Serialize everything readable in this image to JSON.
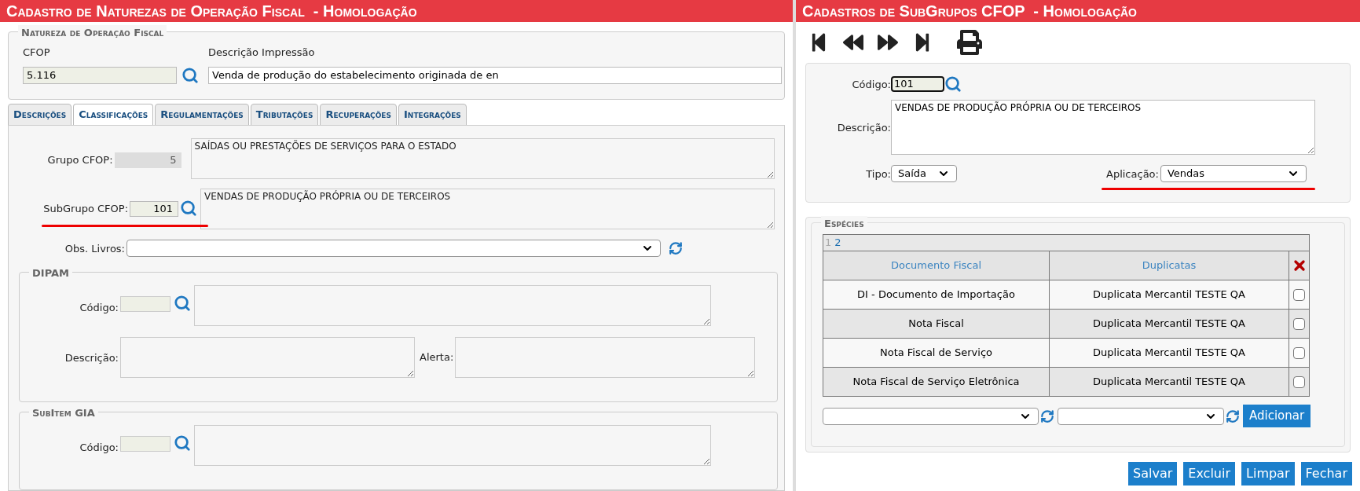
{
  "left_window": {
    "title": "Cadastro de Naturezas de Operação Fiscal  - Homologação",
    "natureza": {
      "legend": "Natureza de Operação Fiscal",
      "cfop_label": "CFOP",
      "cfop_value": "5.116",
      "descricao_label": "Descrição Impressão",
      "descricao_value": "Venda de produção do estabelecimento originada de en"
    },
    "tabs": [
      {
        "label": "Descrições",
        "selected": false
      },
      {
        "label": "Classificações",
        "selected": true
      },
      {
        "label": "Regulamentações",
        "selected": false
      },
      {
        "label": "Tributações",
        "selected": false
      },
      {
        "label": "Recuperações",
        "selected": false
      },
      {
        "label": "Integrações",
        "selected": false
      }
    ],
    "grupo": {
      "label": "Grupo CFOP:",
      "code": "5",
      "description": "SAÍDAS OU PRESTAÇÕES DE SERVIÇOS PARA O ESTADO"
    },
    "subgrupo": {
      "label": "SubGrupo CFOP:",
      "code": "101",
      "description": "VENDAS DE PRODUÇÃO PRÓPRIA OU DE TERCEIROS",
      "underlined": true
    },
    "obs_livros": {
      "label": "Obs. Livros:"
    },
    "dipam": {
      "legend": "DIPAM",
      "codigo_label": "Código:",
      "descricao_label": "Descrição:",
      "alerta_label": "Alerta:"
    },
    "subitem_gia": {
      "legend": "SubItem GIA",
      "codigo_label": "Código:"
    }
  },
  "right_window": {
    "title": "Cadastros de SubGrupos CFOP  - Homologação",
    "codigo": {
      "label": "Código:",
      "value": "101"
    },
    "descricao": {
      "label": "Descrição:",
      "value": "VENDAS DE PRODUÇÃO PRÓPRIA OU DE TERCEIROS"
    },
    "tipo": {
      "label": "Tipo:",
      "value": "Saída"
    },
    "aplicacao": {
      "label": "Aplicação:",
      "value": "Vendas",
      "underlined": true
    },
    "especies": {
      "legend": "Espécies",
      "pages": [
        {
          "label": "1",
          "selected": true
        },
        {
          "label": "2",
          "selected": false
        }
      ],
      "columns": [
        "Documento Fiscal",
        "Duplicatas"
      ],
      "rows": [
        {
          "documento": "DI - Documento de Importação",
          "duplicata": "Duplicata Mercantil TESTE QA",
          "checked": false
        },
        {
          "documento": "Nota Fiscal",
          "duplicata": "Duplicata Mercantil TESTE QA",
          "checked": false
        },
        {
          "documento": "Nota Fiscal de Serviço",
          "duplicata": "Duplicata Mercantil TESTE QA",
          "checked": false
        },
        {
          "documento": "Nota Fiscal de Serviço Eletrônica",
          "duplicata": "Duplicata Mercantil TESTE QA",
          "checked": false
        }
      ],
      "add_button": "Adicionar"
    },
    "buttons": [
      "Salvar",
      "Excluir",
      "Limpar",
      "Fechar"
    ]
  }
}
